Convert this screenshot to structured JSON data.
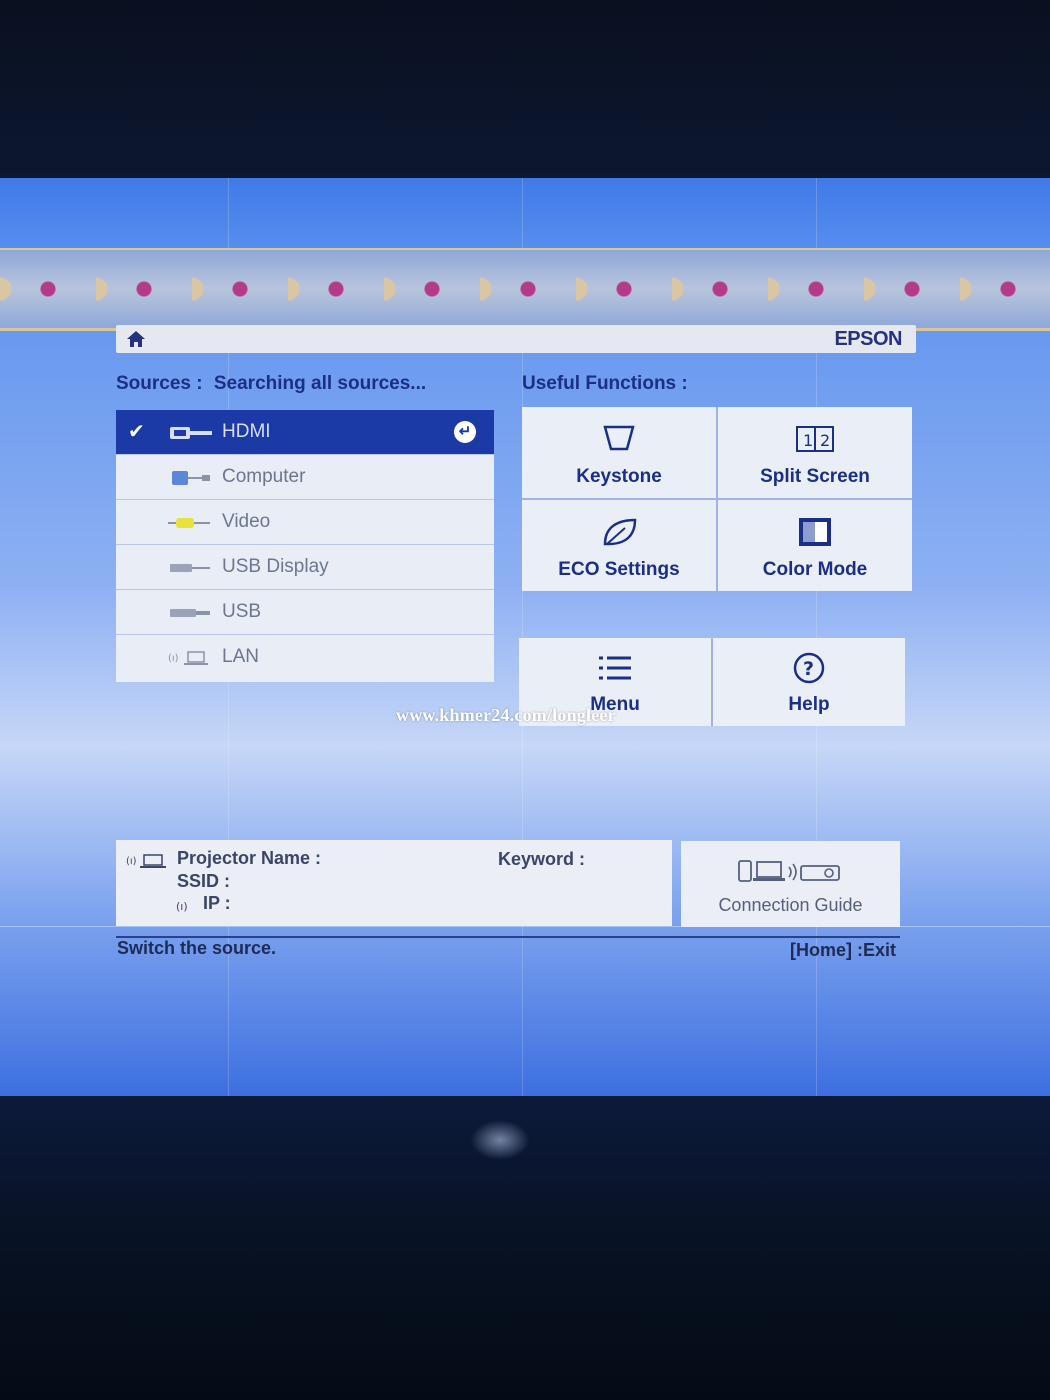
{
  "header": {
    "brand": "EPSON"
  },
  "sources": {
    "label": "Sources :",
    "status": "Searching all sources...",
    "items": [
      {
        "label": "HDMI",
        "selected": true
      },
      {
        "label": "Computer"
      },
      {
        "label": "Video"
      },
      {
        "label": "USB Display"
      },
      {
        "label": "USB"
      },
      {
        "label": "LAN"
      }
    ]
  },
  "useful_functions": {
    "label": "Useful Functions :",
    "tiles": [
      {
        "label": "Keystone",
        "icon": "keystone-icon"
      },
      {
        "label": "Split Screen",
        "icon": "split-screen-icon"
      },
      {
        "label": "ECO Settings",
        "icon": "leaf-icon"
      },
      {
        "label": "Color Mode",
        "icon": "color-mode-icon"
      },
      {
        "label": "Menu",
        "icon": "menu-list-icon"
      },
      {
        "label": "Help",
        "icon": "help-icon"
      }
    ]
  },
  "watermark": "www.khmer24.com/longleer",
  "network": {
    "projector_name_label": "Projector Name :",
    "ssid_label": "SSID :",
    "ip_label": "IP :",
    "keyword_label": "Keyword :"
  },
  "connection_guide": {
    "label": "Connection Guide"
  },
  "footer": {
    "hint": "Switch the source.",
    "exit": "[Home] :Exit"
  },
  "colors": {
    "selected_row": "#1c3aa6",
    "label_text": "#1c2f86",
    "tile_bg": "#eaeef6"
  }
}
